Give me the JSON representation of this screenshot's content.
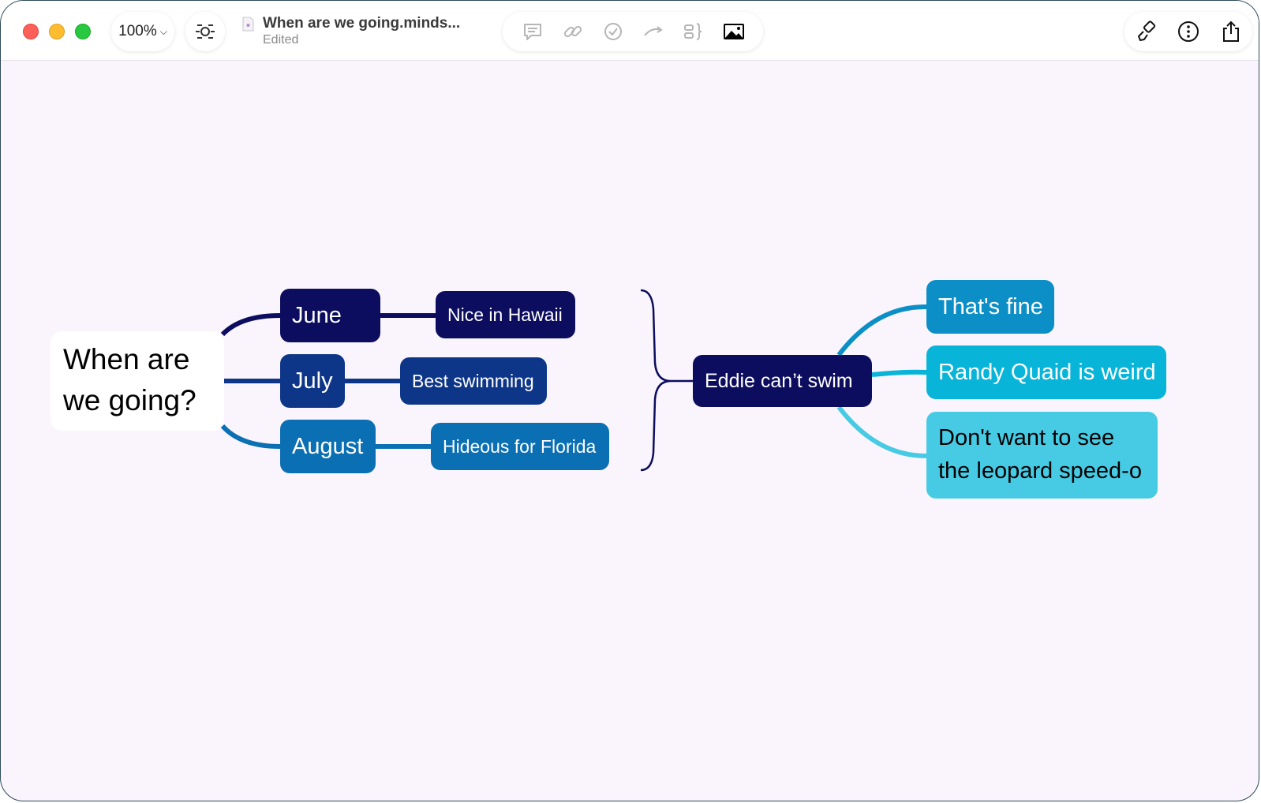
{
  "window": {
    "zoom_label": "100%",
    "doc_title": "When are we going.minds...",
    "doc_status": "Edited"
  },
  "toolbar": {
    "icons": [
      "comment-icon",
      "link-icon",
      "task-icon",
      "relationship-icon",
      "boundary-icon",
      "image-icon"
    ],
    "right_icons": [
      "format-brush-icon",
      "more-icon",
      "share-icon"
    ]
  },
  "mindmap": {
    "root": "When are we going?",
    "months": [
      {
        "label": "June",
        "note": "Nice in Hawaii"
      },
      {
        "label": "July",
        "note": "Best swimming"
      },
      {
        "label": "August",
        "note": "Hideous for Florida"
      }
    ],
    "summary": "Eddie can’t swim",
    "responses": [
      "That's fine",
      "Randy Quaid is weird",
      "Don't want to see the leopard speed-o"
    ]
  },
  "colors": {
    "navy": "#0c0d5e",
    "dark_blue": "#0e3688",
    "mid_blue": "#0b6fb3",
    "teal": "#0c8fc6",
    "cyan": "#08b4d8",
    "light_cyan": "#47cbe4",
    "canvas_bg": "#faf5fc"
  }
}
